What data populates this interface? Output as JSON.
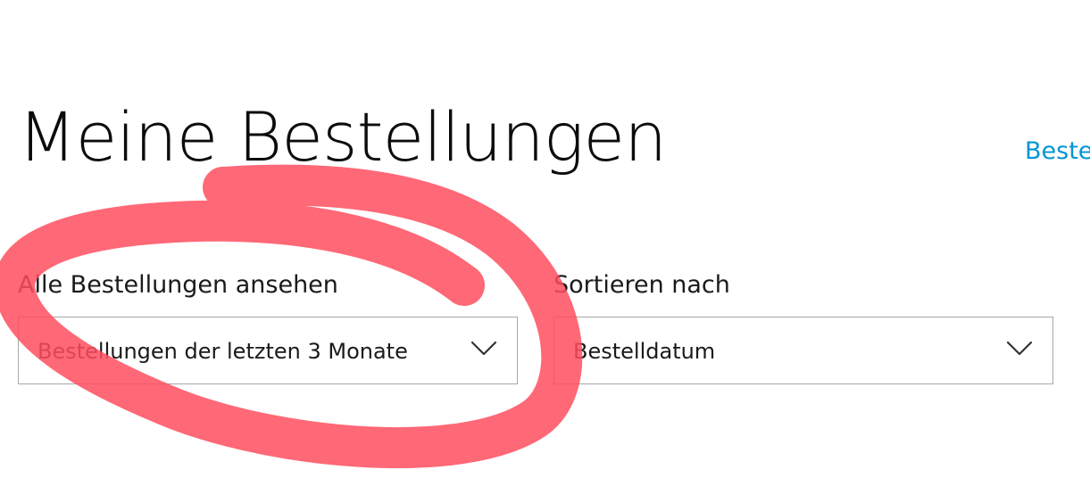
{
  "header": {
    "title": "Meine Bestellungen",
    "link_label": "Beste"
  },
  "filters": {
    "view": {
      "label": "Alle Bestellungen ansehen",
      "selected": "Bestellungen der letzten 3 Monate",
      "icon": "chevron-down-icon"
    },
    "sort": {
      "label": "Sortieren nach",
      "selected": "Bestelldatum",
      "icon": "chevron-down-icon"
    }
  },
  "colors": {
    "link": "#0096d6",
    "annotation": "#ff4d5e",
    "border": "#a8a8a8"
  }
}
